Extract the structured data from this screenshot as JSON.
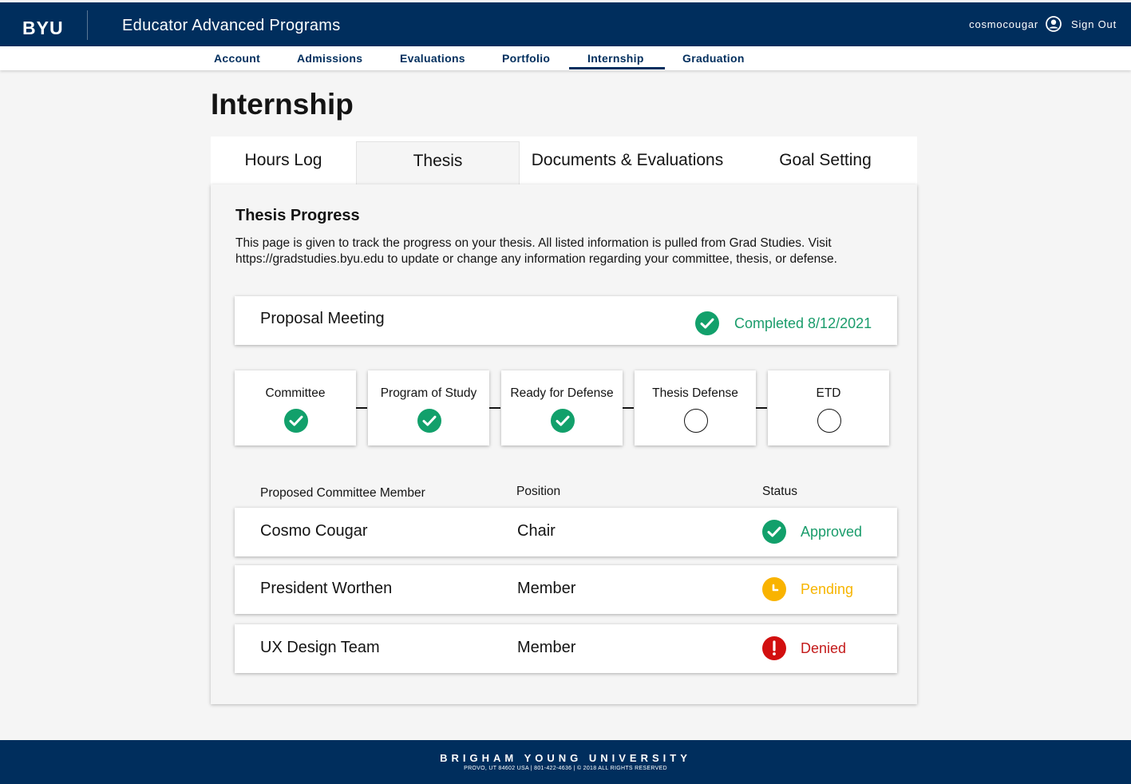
{
  "header": {
    "logo": "BYU",
    "app_title": "Educator Advanced Programs",
    "username": "cosmocougar",
    "sign_out": "Sign Out"
  },
  "nav": {
    "items": [
      {
        "label": "Account"
      },
      {
        "label": "Admissions"
      },
      {
        "label": "Evaluations"
      },
      {
        "label": "Portfolio"
      },
      {
        "label": "Internship",
        "active": true
      },
      {
        "label": "Graduation"
      }
    ]
  },
  "page_title": "Internship",
  "tabs": [
    {
      "label": "Hours Log"
    },
    {
      "label": "Thesis",
      "active": true
    },
    {
      "label": "Documents & Evaluations"
    },
    {
      "label": "Goal Setting"
    }
  ],
  "thesis": {
    "title": "Thesis Progress",
    "description": "This page is given to track the progress on your thesis. All listed information is pulled from Grad Studies. Visit https://gradstudies.byu.edu to update or change any information regarding your committee, thesis, or defense.",
    "proposal": {
      "label": "Proposal Meeting",
      "status": "Completed 8/12/2021"
    },
    "steps": [
      {
        "label": "Committee",
        "done": true
      },
      {
        "label": "Program of Study",
        "done": true
      },
      {
        "label": "Ready for Defense",
        "done": true
      },
      {
        "label": "Thesis Defense",
        "done": false
      },
      {
        "label": "ETD",
        "done": false
      }
    ],
    "columns": {
      "member": "Proposed Committee Member",
      "position": "Position",
      "status": "Status"
    },
    "members": [
      {
        "name": "Cosmo Cougar",
        "position": "Chair",
        "status": "Approved",
        "status_icon": "check-icon"
      },
      {
        "name": "President Worthen",
        "position": "Member",
        "status": "Pending",
        "status_icon": "clock-icon"
      },
      {
        "name": "UX Design Team",
        "position": "Member",
        "status": "Denied",
        "status_icon": "alert-icon"
      }
    ]
  },
  "colors": {
    "brand_navy": "#002e5d",
    "approved_green": "#12a06b",
    "pending_yellow": "#f9b300",
    "denied_red": "#d20f0f"
  },
  "footer": {
    "name": "BRIGHAM YOUNG UNIVERSITY",
    "info": "PROVO, UT 84602 USA  |  801-422-4636  |  © 2018 ALL RIGHTS RESERVED"
  }
}
